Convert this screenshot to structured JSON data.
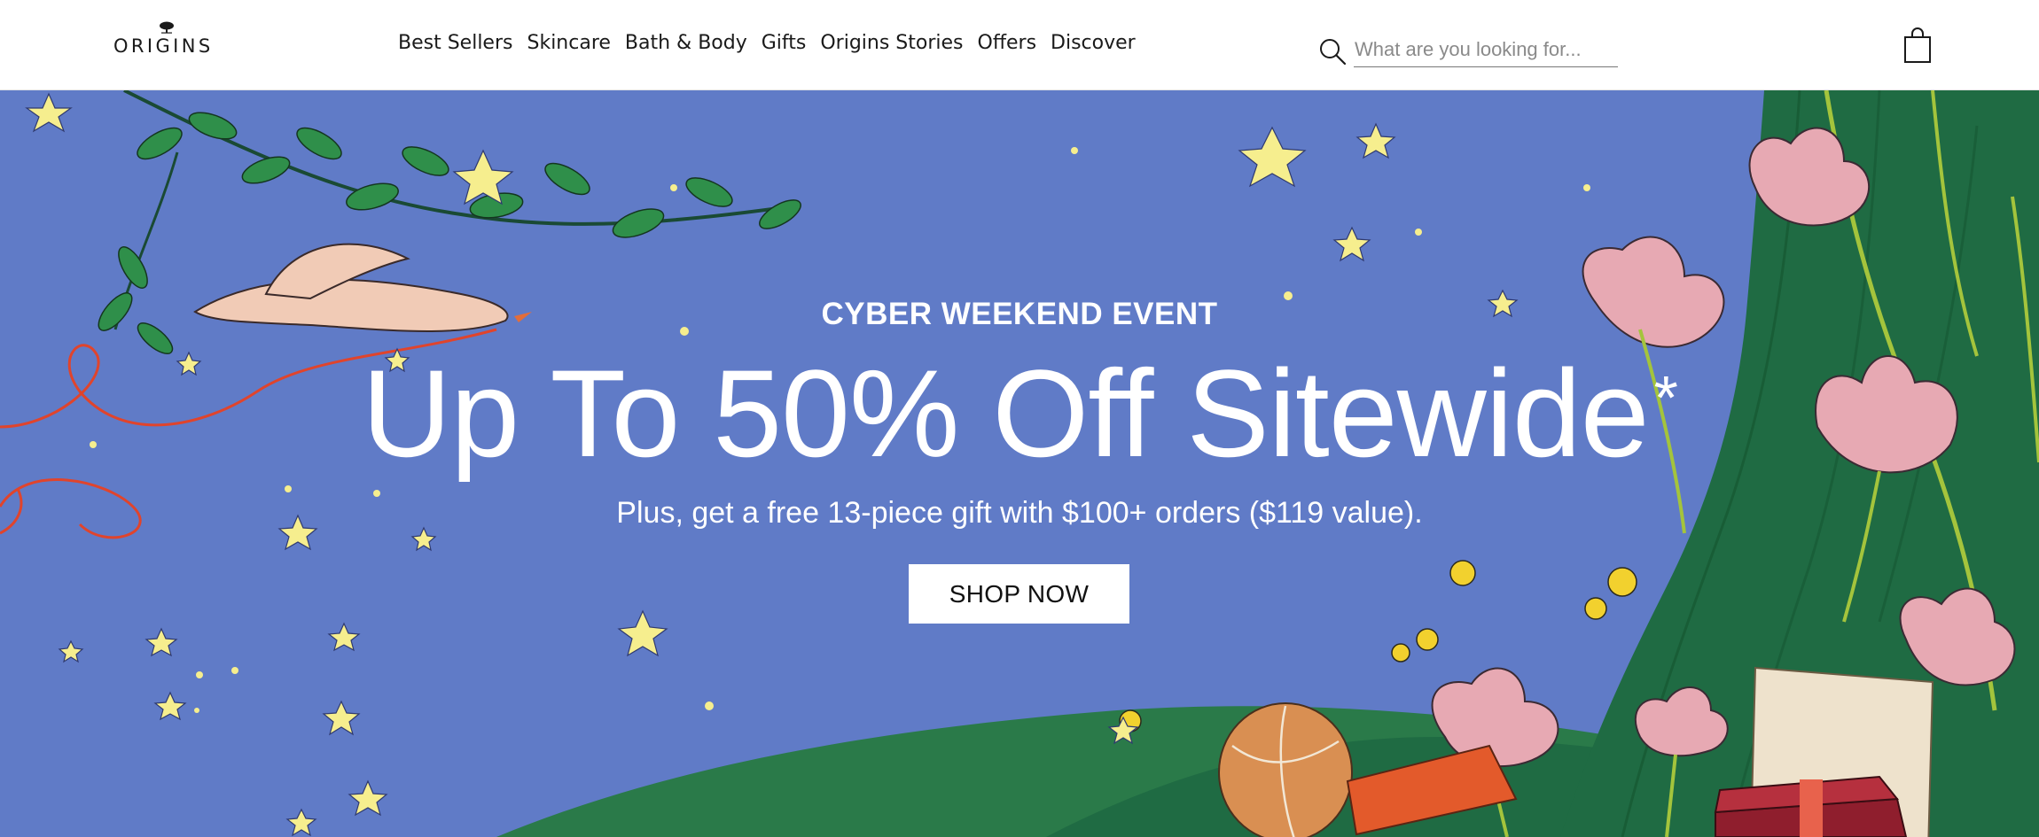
{
  "header": {
    "logo_text": "ORIGINS",
    "nav": [
      {
        "label": "Best Sellers"
      },
      {
        "label": "Skincare"
      },
      {
        "label": "Bath & Body"
      },
      {
        "label": "Gifts"
      },
      {
        "label": "Origins Stories"
      },
      {
        "label": "Offers"
      },
      {
        "label": "Discover"
      }
    ],
    "search": {
      "placeholder": "What are you looking for...",
      "value": ""
    },
    "icons": {
      "search": "search-icon",
      "cart": "shopping-bag-icon",
      "logo_mark": "origins-tree-mark"
    }
  },
  "hero": {
    "eyebrow": "CYBER WEEKEND EVENT",
    "headline": "Up To 50% Off Sitewide",
    "headline_mark": "*",
    "subline": "Plus, get a free 13-piece gift with $100+ orders ($119 value).",
    "cta_label": "SHOP NOW",
    "colors": {
      "sky": "#5e79c6",
      "grass": "#1f6b43",
      "star": "#f6ee8e",
      "flower": "#e7a9b3",
      "cta_bg": "#ffffff"
    }
  }
}
